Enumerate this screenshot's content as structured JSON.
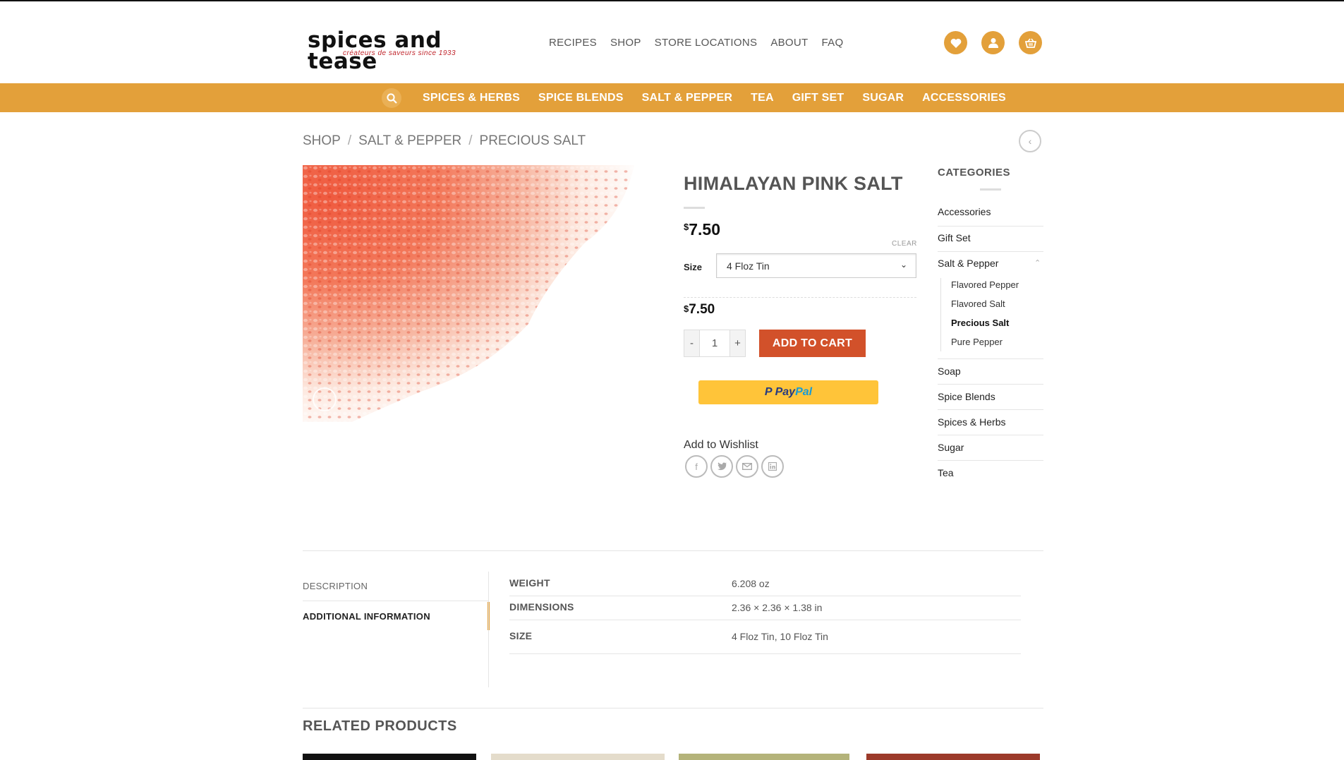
{
  "header": {
    "logo_text": "spices and tease",
    "logo_tagline": "créateurs de saveurs since 1933",
    "nav": [
      "RECIPES",
      "SHOP",
      "STORE LOCATIONS",
      "ABOUT",
      "FAQ"
    ],
    "icons": [
      "heart-icon",
      "user-icon",
      "basket-icon"
    ]
  },
  "category_bar": {
    "items": [
      "SPICES & HERBS",
      "SPICE BLENDS",
      "SALT & PEPPER",
      "TEA",
      "GIFT SET",
      "SUGAR",
      "ACCESSORIES"
    ]
  },
  "breadcrumb": [
    "SHOP",
    "SALT & PEPPER",
    "PRECIOUS SALT"
  ],
  "breadcrumb_sep": "/",
  "product": {
    "title": "HIMALAYAN PINK SALT",
    "currency": "$",
    "price": "7.50",
    "clear_label": "CLEAR",
    "size_label": "Size",
    "size_selected": "4 Floz Tin",
    "variation_price": "7.50",
    "quantity": "1",
    "qty_minus": "-",
    "qty_plus": "+",
    "add_to_cart": "ADD TO CART",
    "paypal_p": "P",
    "paypal_pay": "Pay",
    "paypal_pal": "Pal",
    "wishlist": "Add to Wishlist",
    "share_icons": [
      "facebook-icon",
      "twitter-icon",
      "email-icon",
      "linkedin-icon"
    ]
  },
  "sidebar": {
    "heading": "CATEGORIES",
    "items": [
      "Accessories",
      "Gift Set",
      "Salt & Pepper",
      "Soap",
      "Spice Blends",
      "Spices & Herbs",
      "Sugar",
      "Tea"
    ],
    "subitems": [
      "Flavored Pepper",
      "Flavored Salt",
      "Precious Salt",
      "Pure Pepper"
    ],
    "active_subitem": "Precious Salt"
  },
  "tabs": {
    "items": [
      "DESCRIPTION",
      "ADDITIONAL INFORMATION"
    ],
    "active": "ADDITIONAL INFORMATION"
  },
  "attributes": [
    {
      "key": "WEIGHT",
      "value": "6.208 oz"
    },
    {
      "key": "DIMENSIONS",
      "value": "2.36 × 2.36 × 1.38 in"
    },
    {
      "key": "SIZE",
      "value": "4 Floz Tin, 10 Floz Tin"
    }
  ],
  "related_title": "RELATED PRODUCTS",
  "colors": {
    "accent": "#e3a03a",
    "add_to_cart": "#d2512a",
    "paypal": "#ffc439"
  }
}
